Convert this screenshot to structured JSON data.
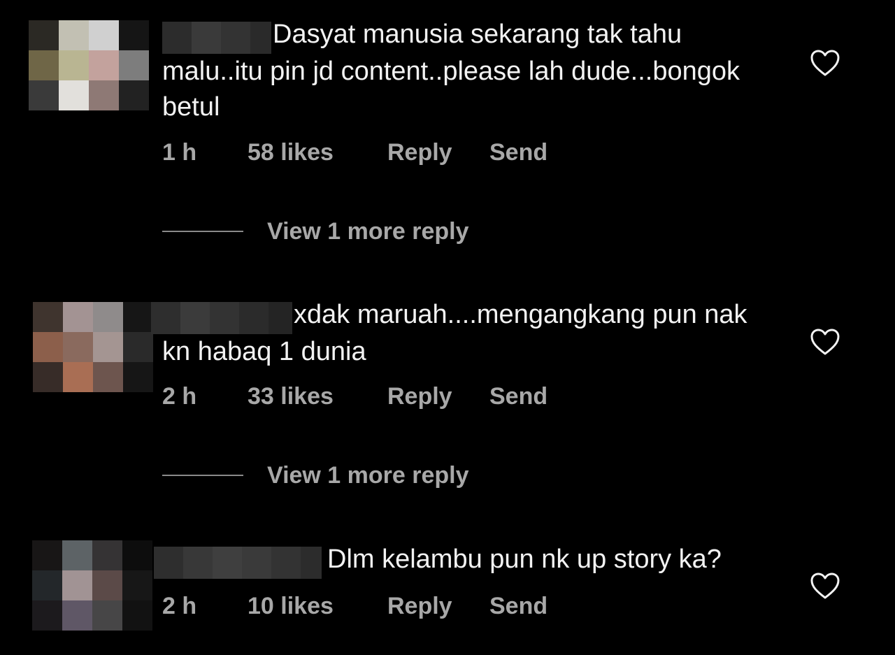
{
  "comments": [
    {
      "text": "Dasyat manusia sekarang tak tahu malu..itu pin jd content..please lah dude...bongok betul",
      "time": "1 h",
      "likes": "58 likes",
      "reply_label": "Reply",
      "send_label": "Send",
      "view_more": "View 1 more reply",
      "avatar_colors": [
        "#2b2924",
        "#c2c0b3",
        "#d0d0d0",
        "#151515",
        "#6f6647",
        "#b9b592",
        "#c3a29d",
        "#7d7d7d",
        "#3a3a3a",
        "#e2e0dc",
        "#8e7975",
        "#222222"
      ]
    },
    {
      "text": "xdak maruah....mengangkang pun nak kn habaq 1 dunia",
      "time": "2 h",
      "likes": "33 likes",
      "reply_label": "Reply",
      "send_label": "Send",
      "view_more": "View 1 more reply",
      "avatar_colors": [
        "#3f342e",
        "#a39393",
        "#8f8b8b",
        "#161616",
        "#8c5f4b",
        "#8a6a5e",
        "#a49592",
        "#2a2a2a",
        "#372c28",
        "#a96e54",
        "#6d554e",
        "#161616"
      ]
    },
    {
      "text": "Dlm kelambu pun nk up story ka?",
      "time": "2 h",
      "likes": "10 likes",
      "reply_label": "Reply",
      "send_label": "Send",
      "view_more": "",
      "avatar_colors": [
        "#181616",
        "#5d6366",
        "#353334",
        "#0d0d0d",
        "#23272a",
        "#a19394",
        "#5b4a48",
        "#171717",
        "#1c1a1d",
        "#5f5766",
        "#474647",
        "#121212"
      ]
    }
  ],
  "colors": {
    "background": "#000000",
    "text": "#f2f2f2",
    "meta": "#a8a8a8"
  }
}
